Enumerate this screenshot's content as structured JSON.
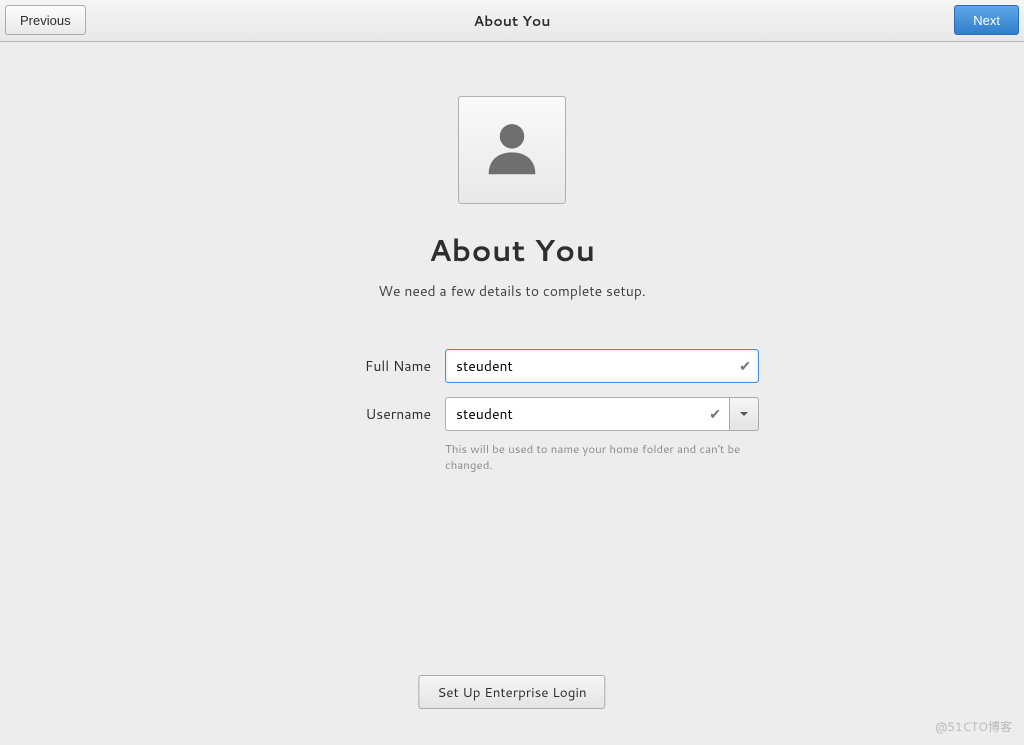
{
  "header": {
    "title": "About You",
    "previous_label": "Previous",
    "next_label": "Next"
  },
  "main": {
    "heading": "About You",
    "subheading": "We need a few details to complete setup."
  },
  "form": {
    "full_name": {
      "label": "Full Name",
      "value": "steudent"
    },
    "username": {
      "label": "Username",
      "value": "steudent",
      "hint": "This will be used to name your home folder and can't be changed."
    }
  },
  "footer": {
    "enterprise_label": "Set Up Enterprise Login"
  },
  "watermark": "@51CTO博客"
}
